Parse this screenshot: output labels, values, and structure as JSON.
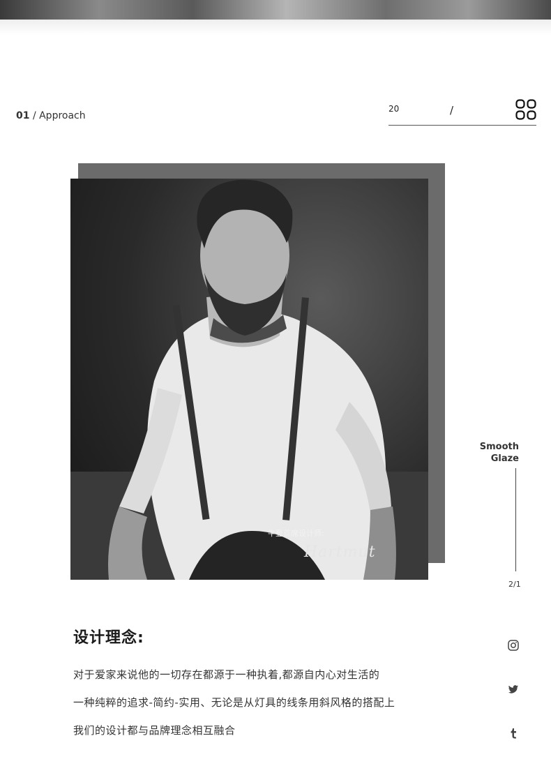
{
  "section": {
    "number": "01",
    "separator": "/",
    "title": "Approach"
  },
  "counter": {
    "current": "20",
    "separator": "/"
  },
  "photo": {
    "caption": "牛登首席设计师:",
    "signature": "Hartmut"
  },
  "side": {
    "line1": "Smooth",
    "line2": "Glaze",
    "page": "2/1"
  },
  "content": {
    "heading": "设计理念:",
    "lines": [
      "对于爱家来说他的一切存在都源于一种执着,都源自内心对生活的",
      "一种纯粹的追求-简约-实用、无论是从灯具的线条用斜风格的搭配上",
      "我们的设计都与品牌理念相互融合"
    ]
  },
  "social": [
    "instagram-icon",
    "twitter-icon",
    "tumblr-icon"
  ],
  "colors": {
    "text": "#222222",
    "photo_back": "#6b6b6b",
    "line": "#444444"
  }
}
